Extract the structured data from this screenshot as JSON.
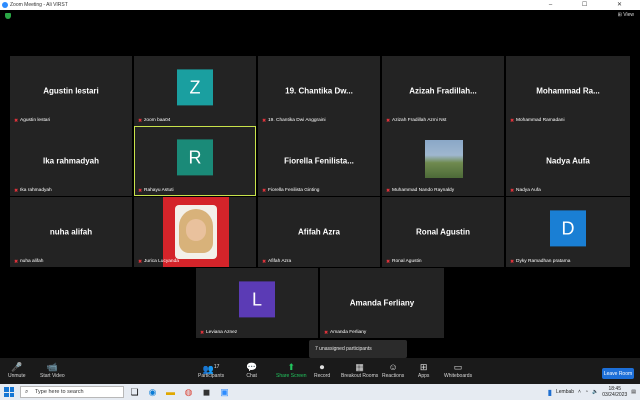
{
  "window": {
    "title": "Zoom Meeting - Ali VIRST",
    "controls": "– ☐ ✕",
    "view_label": "⊞ View"
  },
  "tiles": {
    "agustin": {
      "display": "Agustin lestari",
      "label": "Agustin lestari"
    },
    "zoom": {
      "initial": "Z",
      "label": "zoom baa04",
      "color": "#1a9fa0"
    },
    "chantika": {
      "display": "19. Chantika Dw...",
      "label": "19. Chantika Dwi Anggraini"
    },
    "azizah": {
      "display": "Azizah Fradillah...",
      "label": "Azizah Fradillah Azmi Nst"
    },
    "mohammad": {
      "display": "Mohammad Ra...",
      "label": "Mohammad Ramadani"
    },
    "ika": {
      "display": "Ika rahmadyah",
      "label": "Ika rahmadyah"
    },
    "rahayu": {
      "initial": "R",
      "label": "Rahayu Astuti",
      "color": "#1a8a78"
    },
    "fiorella": {
      "display": "Fiorella Fenilista...",
      "label": "Fiorella Fenilista Ginting"
    },
    "nando": {
      "label": "Muhammad Nando Raynaldy"
    },
    "nadya": {
      "display": "Nadya Aufa",
      "label": "Nadya Aufa"
    },
    "nuha": {
      "display": "nuha alifah",
      "label": "nuha alifah"
    },
    "jurica": {
      "label": "Jurica Lucyanda"
    },
    "afifah": {
      "display": "Afifah Azra",
      "label": "Afifah Azra"
    },
    "ronal": {
      "display": "Ronal Agustin",
      "label": "Ronal Agustin"
    },
    "dyky": {
      "initial": "D",
      "label": "Dyky Ramadhan pratama",
      "color": "#1a7fd4"
    },
    "leviana": {
      "initial": "L",
      "label": "Leviana Aznez",
      "color": "#5b3bb5"
    },
    "amanda": {
      "display": "Amanda Ferliany",
      "label": "Amanda Ferliany"
    }
  },
  "popup": {
    "text": "7 unassigned participants"
  },
  "toolbar": {
    "unmute": "Unmute",
    "start_video": "Start Video",
    "participants": "Participants",
    "participants_count": "17",
    "chat": "Chat",
    "share_screen": "Share Screen",
    "record": "Record",
    "breakout": "Breakout Rooms",
    "reactions": "Reactions",
    "apps": "Apps",
    "whiteboards": "Whiteboards",
    "leave": "Leave Room",
    "accent_green": "#22c55e",
    "leave_color": "#1d6fd8"
  },
  "taskbar": {
    "search_placeholder": "Type here to search",
    "weather": "Lembab",
    "time": "18:45",
    "date": "03/24/2023"
  }
}
